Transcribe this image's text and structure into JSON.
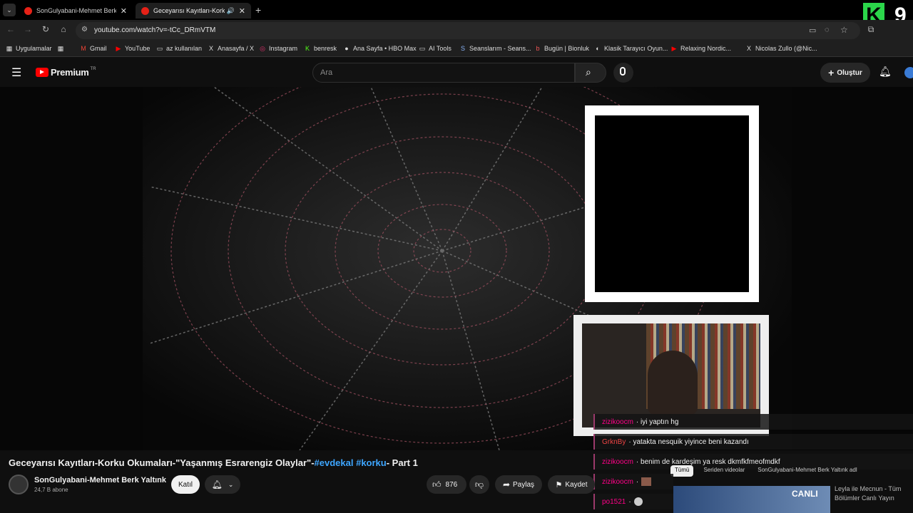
{
  "tabs": [
    {
      "title": "SonGulyabani-Mehmet Berk Ya",
      "close": "✕"
    },
    {
      "title": "Geceyarısı Kayıtları-Korku O",
      "close": "✕"
    }
  ],
  "new_tab": "+",
  "overlay_logo_k": "K",
  "overlay_logo_9": "9",
  "url": "youtube.com/watch?v=-tCc_DRmVTM",
  "bookmarks": [
    "Uygulamalar",
    "Gmail",
    "YouTube",
    "az kullanılan",
    "Anasayfa / X",
    "Instagram",
    "benresk",
    "Ana Sayfa • HBO Max",
    "AI Tools",
    "Seanslarım - Seans...",
    "Bugün | Bionluk",
    "Klasik Tarayıcı Oyun...",
    "Relaxing Nordic...",
    "Nicolas Zullo (@Nic..."
  ],
  "yt": {
    "logo": "Premium",
    "region": "TR",
    "search_placeholder": "Ara",
    "create_label": "Oluştur"
  },
  "chat": [
    {
      "user": "zizikoocm",
      "msg": "· iyi yaptın hg"
    },
    {
      "user": "GrknBy",
      "msg": "· yatakta nesquik yiyince beni kazandı"
    },
    {
      "user": "zizikoocm",
      "msg": "· benim de kardeşim ya resk dkmfkfmeofmdkf"
    },
    {
      "user": "zizikoocm",
      "msg": "·"
    },
    {
      "user": "po1521",
      "msg": "·"
    }
  ],
  "video": {
    "title_main": "Geceyarısı Kayıtları-Korku Okumaları-\"Yaşanmış Esrarengiz Olaylar\"-",
    "tag1": "#evdekal",
    "tag2": "#korku",
    "title_end": "- Part 1"
  },
  "channel": {
    "name": "SonGulyabani-Mehmet Berk Yaltınk",
    "subs": "24,7 B abone",
    "join_label": "Katıl"
  },
  "actions": {
    "likes": "876",
    "share": "Paylaş",
    "save": "Kaydet"
  },
  "right_panel": {
    "chips": [
      "Tümü",
      "Seriden videolar",
      "SonGulyabani-Mehmet Berk Yaltınk adl"
    ],
    "live_badge": "CANLI",
    "rec_title": "Leyla ile Mecnun - Tüm Bölümler Canlı Yayın"
  }
}
